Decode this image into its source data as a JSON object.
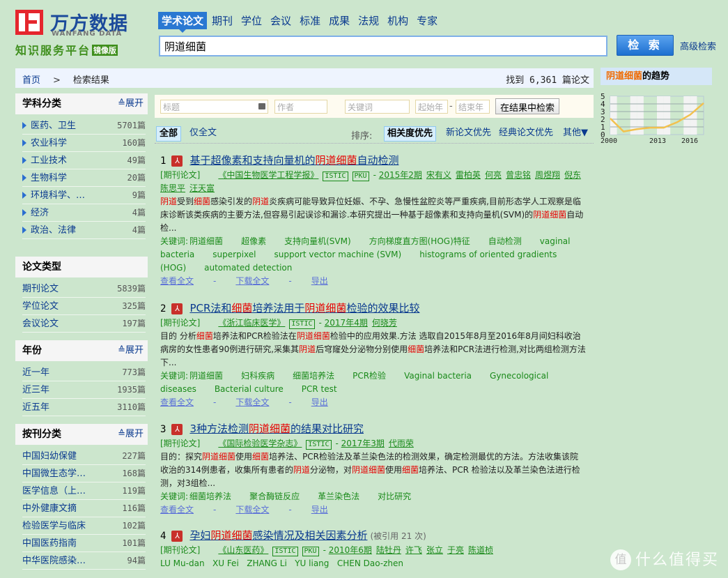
{
  "logo": {
    "name_cn": "万方数据",
    "name_en": "WANFANG DATA",
    "subtitle": "知识服务平台",
    "badge": "镜像版"
  },
  "nav": {
    "tabs": [
      {
        "label": "学术论文",
        "active": true
      },
      {
        "label": "期刊"
      },
      {
        "label": "学位"
      },
      {
        "label": "会议"
      },
      {
        "label": "标准"
      },
      {
        "label": "成果"
      },
      {
        "label": "法规"
      },
      {
        "label": "机构"
      },
      {
        "label": "专家"
      }
    ]
  },
  "search": {
    "query": "阴道细菌",
    "button_label": "检 索",
    "advanced_label": "高级检索"
  },
  "breadcrumb": {
    "home": "首页",
    "separator": ">",
    "current": "检索结果"
  },
  "found_text": "找到 6,361 篇论文",
  "sidebar": {
    "subject": {
      "title": "学科分类",
      "expand": "展开",
      "items": [
        {
          "label": "医药、卫生",
          "count": "5701篇"
        },
        {
          "label": "农业科学",
          "count": "160篇"
        },
        {
          "label": "工业技术",
          "count": "49篇"
        },
        {
          "label": "生物科学",
          "count": "20篇"
        },
        {
          "label": "环境科学、…",
          "count": "9篇"
        },
        {
          "label": "经济",
          "count": "4篇"
        },
        {
          "label": "政治、法律",
          "count": "4篇"
        }
      ]
    },
    "doc_type": {
      "title": "论文类型",
      "items": [
        {
          "label": "期刊论文",
          "count": "5839篇"
        },
        {
          "label": "学位论文",
          "count": "325篇"
        },
        {
          "label": "会议论文",
          "count": "197篇"
        }
      ]
    },
    "year": {
      "title": "年份",
      "expand": "展开",
      "items": [
        {
          "label": "近一年",
          "count": "773篇"
        },
        {
          "label": "近三年",
          "count": "1935篇"
        },
        {
          "label": "近五年",
          "count": "3110篇"
        }
      ]
    },
    "journal": {
      "title": "按刊分类",
      "expand": "展开",
      "items": [
        {
          "label": "中国妇幼保健",
          "count": "227篇"
        },
        {
          "label": "中国微生态学…",
          "count": "168篇"
        },
        {
          "label": "医学信息（上…",
          "count": "119篇"
        },
        {
          "label": "中外健康文摘",
          "count": "116篇"
        },
        {
          "label": "检验医学与临床",
          "count": "102篇"
        },
        {
          "label": "中国医药指南",
          "count": "101篇"
        },
        {
          "label": "中华医院感染…",
          "count": "94篇"
        }
      ]
    }
  },
  "filter": {
    "title_placeholder": "标题",
    "author_placeholder": "作者",
    "keyword_placeholder": "关键词",
    "start_year_placeholder": "起始年",
    "end_year_placeholder": "结束年",
    "dash": "-",
    "search_in_results": "在结果中检索"
  },
  "sort": {
    "tab_all": "全部",
    "tab_fulltext": "仅全文",
    "label": "排序:",
    "options": [
      "相关度优先",
      "新论文优先",
      "经典论文优先",
      "其他▼"
    ]
  },
  "actions": {
    "view": "查看全文",
    "download": "下载全文",
    "export": "导出",
    "sep": "-"
  },
  "results": [
    {
      "num": "1",
      "title_parts": [
        {
          "t": "基于超像素和支持向量机的"
        },
        {
          "t": "阴道细菌",
          "hl": true
        },
        {
          "t": "自动检测"
        }
      ],
      "type": "[期刊论文]",
      "journal": "《中国生物医学工程学报》",
      "tags": [
        "ISTIC",
        "PKU"
      ],
      "issue": "2015年2期",
      "authors": [
        "宋有义",
        "雷柏英",
        "何亮",
        "曾忠铭",
        "周煜翔",
        "倪东",
        "陈思平",
        "汪天富"
      ],
      "abstract_parts": [
        {
          "t": "阴道",
          "hl": true
        },
        {
          "t": "受到"
        },
        {
          "t": "细菌",
          "hl": true
        },
        {
          "t": "感染引发的"
        },
        {
          "t": "阴道",
          "hl": true
        },
        {
          "t": "炎疾病可能导致异位妊娠、不孕、急慢性盆腔炎等严重疾病,目前形态学人工观察是临床诊断该类疾病的主要方法,但容易引起误诊和漏诊.本研究提出一种基于超像素和支持向量机(SVM)的"
        },
        {
          "t": "阴道细菌",
          "hl": true
        },
        {
          "t": "自动检..."
        }
      ],
      "keywords_label": "关键词:",
      "keywords": [
        "阴道细菌",
        "超像素",
        "支持向量机(SVM)",
        "方向梯度直方图(HOG)特征",
        "自动检测",
        "vaginal bacteria",
        "superpixel",
        "support vector machine (SVM)",
        "histograms of oriented gradients (HOG)",
        "automated detection"
      ]
    },
    {
      "num": "2",
      "title_parts": [
        {
          "t": "PCR法和"
        },
        {
          "t": "细菌",
          "hl": true
        },
        {
          "t": "培养法用于"
        },
        {
          "t": "阴道细菌",
          "hl": true
        },
        {
          "t": "检验的效果比较"
        }
      ],
      "type": "[期刊论文]",
      "journal": "《浙江临床医学》",
      "tags": [
        "ISTIC"
      ],
      "issue": "2017年4期",
      "authors": [
        "何晓芳"
      ],
      "abstract_parts": [
        {
          "t": "目的 分析"
        },
        {
          "t": "细菌",
          "hl": true
        },
        {
          "t": "培养法和PCR检验法在"
        },
        {
          "t": "阴道细菌",
          "hl": true
        },
        {
          "t": "检验中的应用效果.方法 选取自2015年8月至2016年8月间妇科收治病房的女性患者90例进行研究,采集其"
        },
        {
          "t": "阴道",
          "hl": true
        },
        {
          "t": "后穹窿处分泌物分别使用"
        },
        {
          "t": "细菌",
          "hl": true
        },
        {
          "t": "培养法和PCR法进行检测,对比两组检测方法下..."
        }
      ],
      "keywords_label": "关键词:",
      "keywords": [
        "阴道细菌",
        "妇科疾病",
        "细菌培养法",
        "PCR检验",
        "Vaginal bacteria",
        "Gynecological diseases",
        "Bacterial culture",
        "PCR test"
      ]
    },
    {
      "num": "3",
      "title_parts": [
        {
          "t": "3种方法检测"
        },
        {
          "t": "阴道细菌",
          "hl": true
        },
        {
          "t": "的结果对比研究"
        }
      ],
      "type": "[期刊论文]",
      "journal": "《国际检验医学杂志》",
      "tags": [
        "ISTIC"
      ],
      "issue": "2017年3期",
      "authors": [
        "代雨荣"
      ],
      "abstract_parts": [
        {
          "t": "目的：探究"
        },
        {
          "t": "阴道细菌",
          "hl": true
        },
        {
          "t": "使用"
        },
        {
          "t": "细菌",
          "hl": true
        },
        {
          "t": "培养法、PCR检验法及革兰染色法的检测效果，确定检测最优的方法。方法收集该院收治的314例患者，收集所有患者的"
        },
        {
          "t": "阴道",
          "hl": true
        },
        {
          "t": "分泌物，对"
        },
        {
          "t": "阴道细菌",
          "hl": true
        },
        {
          "t": "使用"
        },
        {
          "t": "细菌",
          "hl": true
        },
        {
          "t": "培养法、PCR 检验法以及革兰染色法进行检测，对3组检..."
        }
      ],
      "keywords_label": "关键词:",
      "keywords": [
        "细菌培养法",
        "聚合酶链反应",
        "革兰染色法",
        "对比研究"
      ]
    },
    {
      "num": "4",
      "title_parts": [
        {
          "t": "孕妇"
        },
        {
          "t": "阴道细菌",
          "hl": true
        },
        {
          "t": "感染情况及相关因素分析"
        }
      ],
      "cited": "(被引用  21  次)",
      "type": "[期刊论文]",
      "journal": "《山东医药》",
      "tags": [
        "ISTIC",
        "PKU"
      ],
      "issue": "2010年6期",
      "authors": [
        "陆牡丹",
        "许飞",
        "张立",
        "于亮",
        "陈道桢"
      ],
      "authors_en": "LU Mu-dan   XU Fei   ZHANG Li   YU liang   CHEN Dao-zhen"
    }
  ],
  "trend": {
    "title_hl": "阴道细菌",
    "title_rest": "的趋势"
  },
  "chart_data": {
    "type": "line",
    "title": "阴道细菌的趋势",
    "x_tick_labels": [
      "2000",
      "2013",
      "2016"
    ],
    "y_tick_labels": [
      "0",
      "1",
      "2",
      "3",
      "4",
      "5"
    ],
    "ylim": [
      0,
      5
    ],
    "series": [
      {
        "name": "trend",
        "color": "#f2c14e",
        "values": [
          2.1,
          0.4,
          0.7,
          0.9,
          0.9,
          1.6,
          2.6,
          4.1
        ]
      }
    ],
    "grid": true
  },
  "watermark": {
    "icon": "值",
    "text": "什么值得买"
  }
}
